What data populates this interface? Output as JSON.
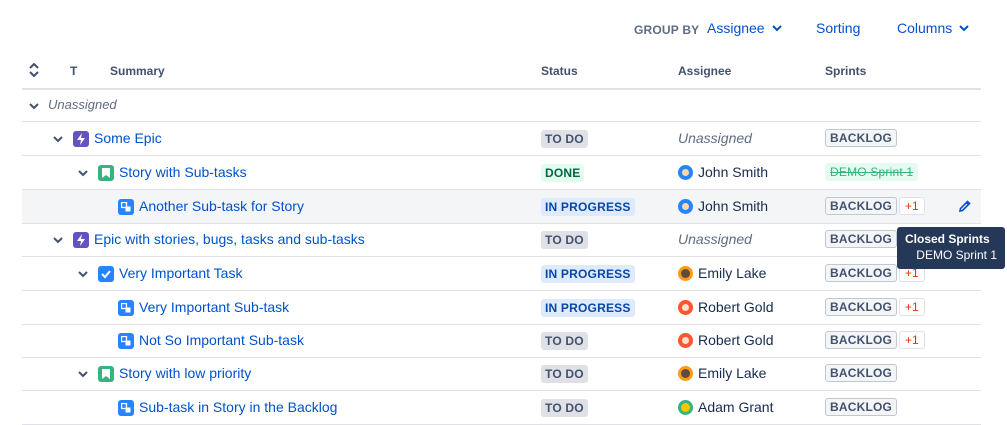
{
  "toolbar": {
    "group_by_label": "GROUP BY",
    "group_by_value": "Assignee",
    "sorting_label": "Sorting",
    "columns_label": "Columns"
  },
  "columns": {
    "type": "T",
    "summary": "Summary",
    "status": "Status",
    "assignee": "Assignee",
    "sprints": "Sprints"
  },
  "group": {
    "label": "Unassigned"
  },
  "rows": [
    {
      "summary": "Some Epic",
      "status": "TO DO",
      "assignee": "Unassigned",
      "sprint": "BACKLOG",
      "plus": ""
    },
    {
      "summary": "Story with Sub-tasks",
      "status": "DONE",
      "assignee": "John Smith",
      "sprint": "DEMO Sprint 1",
      "plus": ""
    },
    {
      "summary": "Another Sub-task for Story",
      "status": "IN PROGRESS",
      "assignee": "John Smith",
      "sprint": "BACKLOG",
      "plus": "+1"
    },
    {
      "summary": "Epic with stories, bugs, tasks and sub-tasks",
      "status": "TO DO",
      "assignee": "Unassigned",
      "sprint": "BACKLOG",
      "plus": ""
    },
    {
      "summary": "Very Important Task",
      "status": "IN PROGRESS",
      "assignee": "Emily Lake",
      "sprint": "BACKLOG",
      "plus": "+1"
    },
    {
      "summary": "Very Important Sub-task",
      "status": "IN PROGRESS",
      "assignee": "Robert Gold",
      "sprint": "BACKLOG",
      "plus": "+1"
    },
    {
      "summary": "Not So Important Sub-task",
      "status": "TO DO",
      "assignee": "Robert Gold",
      "sprint": "BACKLOG",
      "plus": "+1"
    },
    {
      "summary": "Story with low priority",
      "status": "TO DO",
      "assignee": "Emily Lake",
      "sprint": "BACKLOG",
      "plus": ""
    },
    {
      "summary": "Sub-task in Story in the Backlog",
      "status": "TO DO",
      "assignee": "Adam Grant",
      "sprint": "BACKLOG",
      "plus": ""
    }
  ],
  "tooltip": {
    "title": "Closed Sprints",
    "body": "DEMO Sprint 1"
  },
  "colors": {
    "epic": "#6554c0",
    "story": "#36b37e",
    "task": "#2684ff",
    "subtask": "#2684ff",
    "link": "#0052cc"
  }
}
